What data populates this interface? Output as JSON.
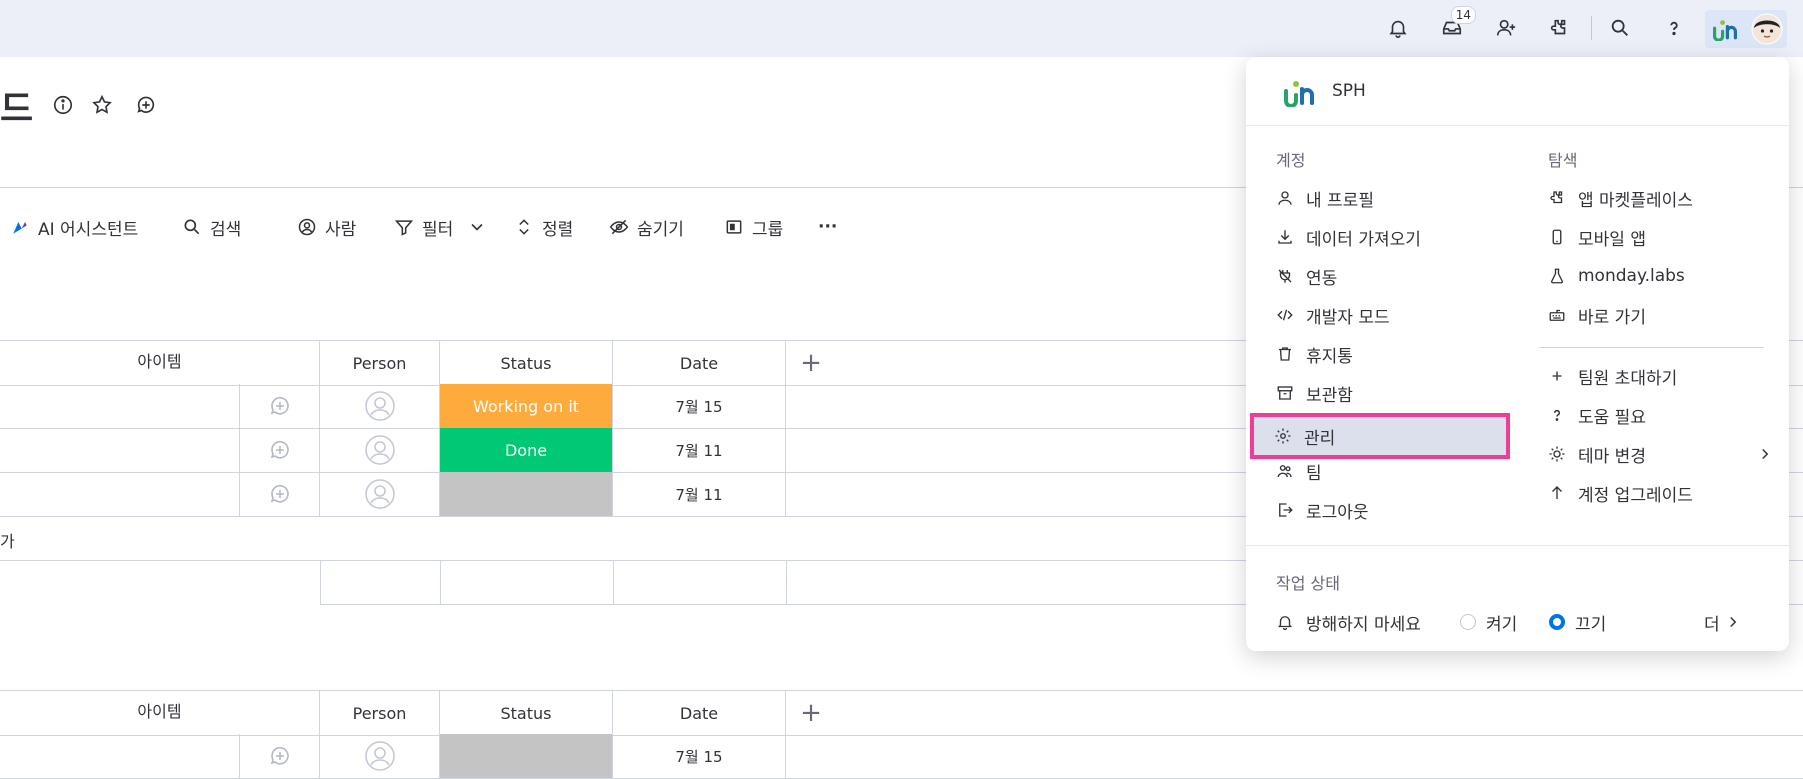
{
  "topbar": {
    "icons": [
      "bell-icon",
      "inbox-icon",
      "invite-icon",
      "apps-icon",
      "search-icon",
      "help-icon"
    ],
    "inbox_badge": "14"
  },
  "board": {
    "title": "드"
  },
  "toolbar": {
    "ai_label": "AI 어시스턴트",
    "search_label": "검색",
    "person_label": "사람",
    "filter_label": "필터",
    "sort_label": "정렬",
    "hide_label": "숨기기",
    "group_label": "그룹",
    "more_label": "···"
  },
  "table1": {
    "headers": {
      "item": "아이템",
      "person": "Person",
      "status": "Status",
      "date": "Date",
      "add": "+"
    },
    "rows": [
      {
        "status": "Working on it",
        "date": "7월 15"
      },
      {
        "status": "Done",
        "date": "7월 11"
      },
      {
        "status": "",
        "date": "7월 11"
      }
    ],
    "add_row": "가"
  },
  "table2": {
    "headers": {
      "item": "아이템",
      "person": "Person",
      "status": "Status",
      "date": "Date",
      "add": "+"
    },
    "rows": [
      {
        "status": "",
        "date": "7월 15"
      }
    ]
  },
  "menu": {
    "org": "SPH",
    "account_title": "계정",
    "explore_title": "탐색",
    "account_items": [
      "내 프로필",
      "데이터 가져오기",
      "연동",
      "개발자 모드",
      "휴지통",
      "보관함",
      "관리",
      "팀",
      "로그아웃"
    ],
    "explore_items": [
      "앱 마켓플레이스",
      "모바일 앱",
      "monday.labs",
      "바로 가기"
    ],
    "extra_items": [
      "팀원 초대하기",
      "도움 필요",
      "테마 변경",
      "계정 업그레이드"
    ],
    "work_status_title": "작업 상태",
    "dnd_label": "방해하지 마세요",
    "on_label": "켜기",
    "off_label": "끄기",
    "more_label": "더"
  },
  "colors": {
    "accent": "#0073ea",
    "highlight_border": "#ec3d97",
    "working": "#fdab3d",
    "done": "#00c875",
    "empty": "#c4c4c4"
  }
}
